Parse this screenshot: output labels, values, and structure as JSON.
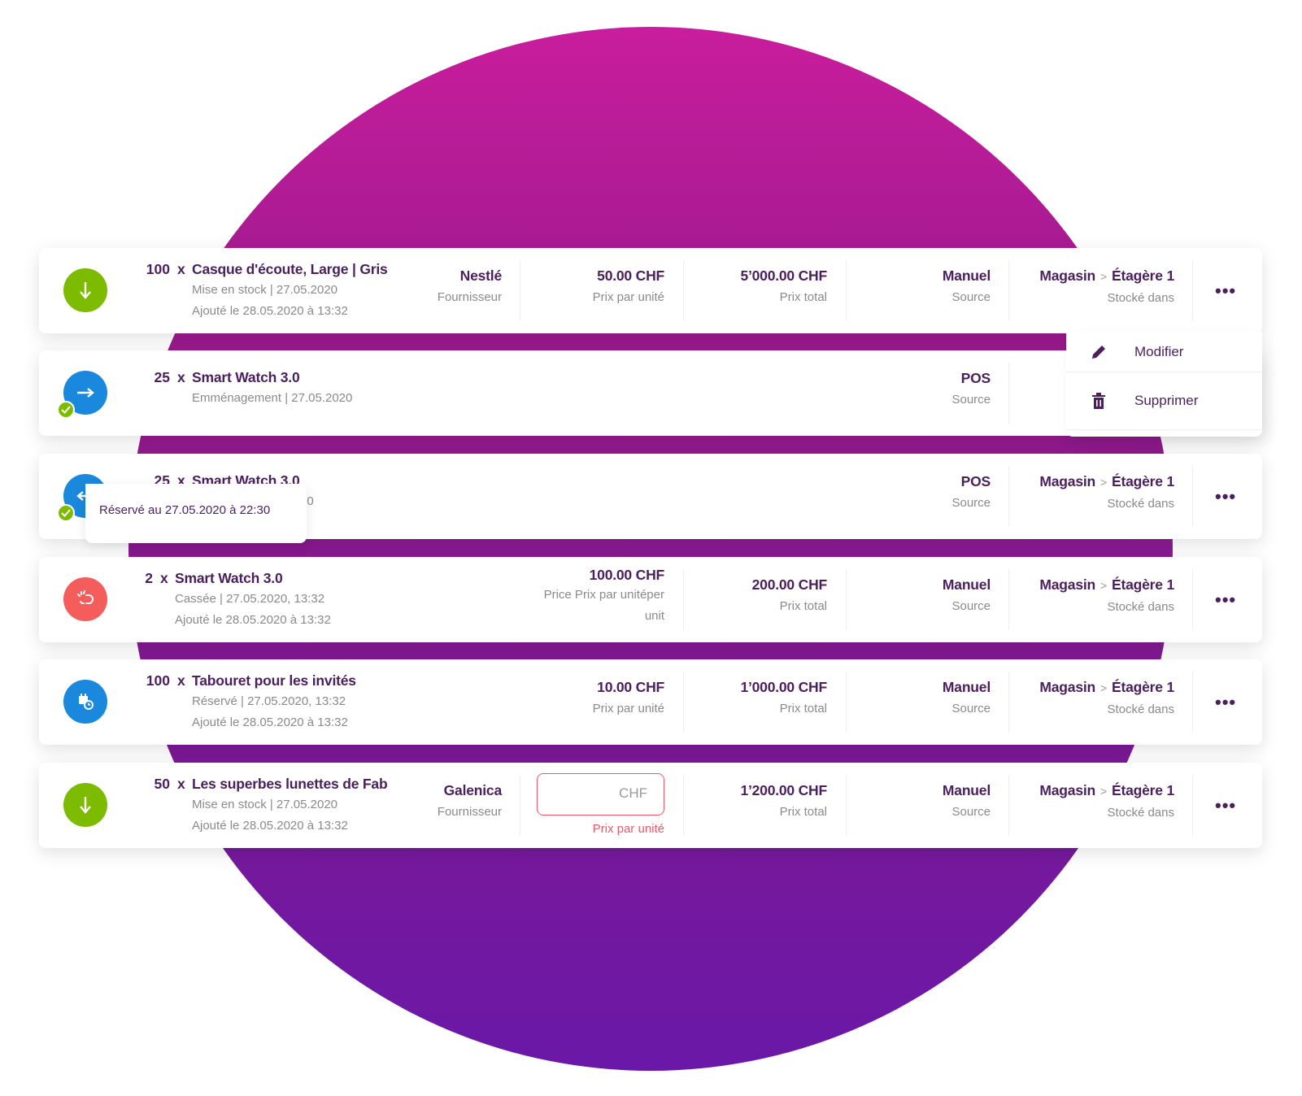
{
  "colors": {
    "accent": "#4b1f5e",
    "green": "#7dbb00",
    "blue": "#1a88dc",
    "red": "#f55d5d",
    "error": "#f0566a"
  },
  "menu": {
    "edit": "Modifier",
    "delete": "Supprimer"
  },
  "tooltip": "Réservé au 27.05.2020 à 22:30",
  "rows": [
    {
      "icon": "arrow-down-icon",
      "qty": "100",
      "x": "x",
      "name": "Casque d'écoute, Large | Gris",
      "sub1": "Mise en stock | 27.05.2020",
      "sub2": "Ajouté le 28.05.2020 à 13:32",
      "supplier": "Nestlé",
      "supplier_label": "Fournisseur",
      "price": "50.00 CHF",
      "price_label": "Prix par unité",
      "total": "5’000.00 CHF",
      "total_label": "Prix total",
      "source": "Manuel",
      "source_label": "Source",
      "store": "Magasin",
      "shelf": "Étagère 1",
      "stored_label": "Stocké dans"
    },
    {
      "icon": "arrow-right-icon",
      "qty": "25",
      "x": "x",
      "name": "Smart Watch 3.0",
      "sub1": "Emménagement | 27.05.2020",
      "source": "POS",
      "source_label": "Source"
    },
    {
      "icon": "arrow-left-icon",
      "qty": "25",
      "x": "x",
      "name": "Smart Watch 3.0",
      "sub1_partial": "20",
      "source": "POS",
      "source_label": "Source",
      "store": "Magasin",
      "shelf": "Étagère 1",
      "stored_label": "Stocké dans"
    },
    {
      "icon": "broken-link-icon",
      "qty": "2",
      "x": "x",
      "name": "Smart Watch 3.0",
      "sub1": "Cassée | 27.05.2020, 13:32",
      "sub2": "Ajouté le 28.05.2020 à 13:32",
      "price": "100.00 CHF",
      "price_label": "Price Prix par unitéper",
      "price_label2": "unit",
      "total": "200.00 CHF",
      "total_label": "Prix total",
      "source": "Manuel",
      "source_label": "Source",
      "store": "Magasin",
      "shelf": "Étagère 1",
      "stored_label": "Stocké dans"
    },
    {
      "icon": "calendar-clock-icon",
      "qty": "100",
      "x": "x",
      "name": "Tabouret pour les invités",
      "sub1": "Réservé | 27.05.2020, 13:32",
      "sub2": "Ajouté le 28.05.2020 à 13:32",
      "price": "10.00 CHF",
      "price_label": "Prix par unité",
      "total": "1’000.00 CHF",
      "total_label": "Prix total",
      "source": "Manuel",
      "source_label": "Source",
      "store": "Magasin",
      "shelf": "Étagère 1",
      "stored_label": "Stocké dans"
    },
    {
      "icon": "arrow-down-icon",
      "qty": "50",
      "x": "x",
      "name": "Les superbes lunettes de Fab",
      "sub1": "Mise en stock | 27.05.2020",
      "sub2": "Ajouté le 28.05.2020 à 13:32",
      "supplier": "Galenica",
      "supplier_label": "Fournisseur",
      "price_input": "",
      "price_placeholder": "CHF",
      "price_label": "Prix par unité",
      "total": "1’200.00 CHF",
      "total_label": "Prix total",
      "source": "Manuel",
      "source_label": "Source",
      "store": "Magasin",
      "shelf": "Étagère 1",
      "stored_label": "Stocké dans"
    }
  ]
}
